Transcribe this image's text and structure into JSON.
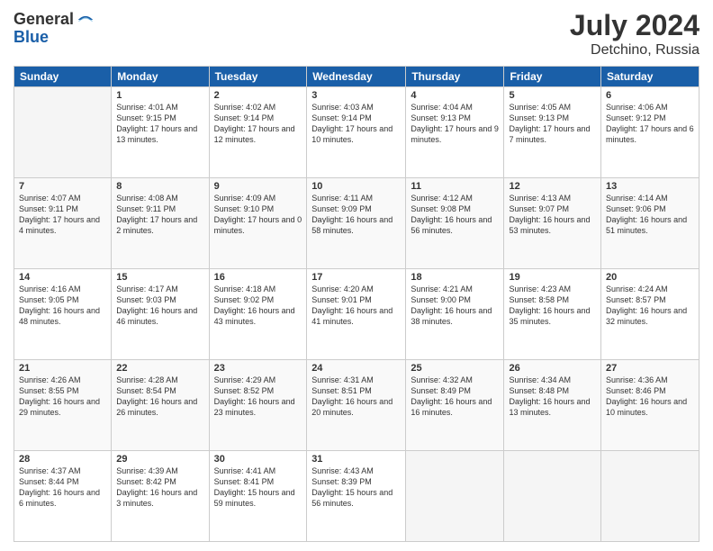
{
  "logo": {
    "general": "General",
    "blue": "Blue"
  },
  "header": {
    "month_year": "July 2024",
    "location": "Detchino, Russia"
  },
  "days_of_week": [
    "Sunday",
    "Monday",
    "Tuesday",
    "Wednesday",
    "Thursday",
    "Friday",
    "Saturday"
  ],
  "weeks": [
    [
      {
        "day": "",
        "info": ""
      },
      {
        "day": "1",
        "info": "Sunrise: 4:01 AM\nSunset: 9:15 PM\nDaylight: 17 hours\nand 13 minutes."
      },
      {
        "day": "2",
        "info": "Sunrise: 4:02 AM\nSunset: 9:14 PM\nDaylight: 17 hours\nand 12 minutes."
      },
      {
        "day": "3",
        "info": "Sunrise: 4:03 AM\nSunset: 9:14 PM\nDaylight: 17 hours\nand 10 minutes."
      },
      {
        "day": "4",
        "info": "Sunrise: 4:04 AM\nSunset: 9:13 PM\nDaylight: 17 hours\nand 9 minutes."
      },
      {
        "day": "5",
        "info": "Sunrise: 4:05 AM\nSunset: 9:13 PM\nDaylight: 17 hours\nand 7 minutes."
      },
      {
        "day": "6",
        "info": "Sunrise: 4:06 AM\nSunset: 9:12 PM\nDaylight: 17 hours\nand 6 minutes."
      }
    ],
    [
      {
        "day": "7",
        "info": "Sunrise: 4:07 AM\nSunset: 9:11 PM\nDaylight: 17 hours\nand 4 minutes."
      },
      {
        "day": "8",
        "info": "Sunrise: 4:08 AM\nSunset: 9:11 PM\nDaylight: 17 hours\nand 2 minutes."
      },
      {
        "day": "9",
        "info": "Sunrise: 4:09 AM\nSunset: 9:10 PM\nDaylight: 17 hours\nand 0 minutes."
      },
      {
        "day": "10",
        "info": "Sunrise: 4:11 AM\nSunset: 9:09 PM\nDaylight: 16 hours\nand 58 minutes."
      },
      {
        "day": "11",
        "info": "Sunrise: 4:12 AM\nSunset: 9:08 PM\nDaylight: 16 hours\nand 56 minutes."
      },
      {
        "day": "12",
        "info": "Sunrise: 4:13 AM\nSunset: 9:07 PM\nDaylight: 16 hours\nand 53 minutes."
      },
      {
        "day": "13",
        "info": "Sunrise: 4:14 AM\nSunset: 9:06 PM\nDaylight: 16 hours\nand 51 minutes."
      }
    ],
    [
      {
        "day": "14",
        "info": "Sunrise: 4:16 AM\nSunset: 9:05 PM\nDaylight: 16 hours\nand 48 minutes."
      },
      {
        "day": "15",
        "info": "Sunrise: 4:17 AM\nSunset: 9:03 PM\nDaylight: 16 hours\nand 46 minutes."
      },
      {
        "day": "16",
        "info": "Sunrise: 4:18 AM\nSunset: 9:02 PM\nDaylight: 16 hours\nand 43 minutes."
      },
      {
        "day": "17",
        "info": "Sunrise: 4:20 AM\nSunset: 9:01 PM\nDaylight: 16 hours\nand 41 minutes."
      },
      {
        "day": "18",
        "info": "Sunrise: 4:21 AM\nSunset: 9:00 PM\nDaylight: 16 hours\nand 38 minutes."
      },
      {
        "day": "19",
        "info": "Sunrise: 4:23 AM\nSunset: 8:58 PM\nDaylight: 16 hours\nand 35 minutes."
      },
      {
        "day": "20",
        "info": "Sunrise: 4:24 AM\nSunset: 8:57 PM\nDaylight: 16 hours\nand 32 minutes."
      }
    ],
    [
      {
        "day": "21",
        "info": "Sunrise: 4:26 AM\nSunset: 8:55 PM\nDaylight: 16 hours\nand 29 minutes."
      },
      {
        "day": "22",
        "info": "Sunrise: 4:28 AM\nSunset: 8:54 PM\nDaylight: 16 hours\nand 26 minutes."
      },
      {
        "day": "23",
        "info": "Sunrise: 4:29 AM\nSunset: 8:52 PM\nDaylight: 16 hours\nand 23 minutes."
      },
      {
        "day": "24",
        "info": "Sunrise: 4:31 AM\nSunset: 8:51 PM\nDaylight: 16 hours\nand 20 minutes."
      },
      {
        "day": "25",
        "info": "Sunrise: 4:32 AM\nSunset: 8:49 PM\nDaylight: 16 hours\nand 16 minutes."
      },
      {
        "day": "26",
        "info": "Sunrise: 4:34 AM\nSunset: 8:48 PM\nDaylight: 16 hours\nand 13 minutes."
      },
      {
        "day": "27",
        "info": "Sunrise: 4:36 AM\nSunset: 8:46 PM\nDaylight: 16 hours\nand 10 minutes."
      }
    ],
    [
      {
        "day": "28",
        "info": "Sunrise: 4:37 AM\nSunset: 8:44 PM\nDaylight: 16 hours\nand 6 minutes."
      },
      {
        "day": "29",
        "info": "Sunrise: 4:39 AM\nSunset: 8:42 PM\nDaylight: 16 hours\nand 3 minutes."
      },
      {
        "day": "30",
        "info": "Sunrise: 4:41 AM\nSunset: 8:41 PM\nDaylight: 15 hours\nand 59 minutes."
      },
      {
        "day": "31",
        "info": "Sunrise: 4:43 AM\nSunset: 8:39 PM\nDaylight: 15 hours\nand 56 minutes."
      },
      {
        "day": "",
        "info": ""
      },
      {
        "day": "",
        "info": ""
      },
      {
        "day": "",
        "info": ""
      }
    ]
  ]
}
